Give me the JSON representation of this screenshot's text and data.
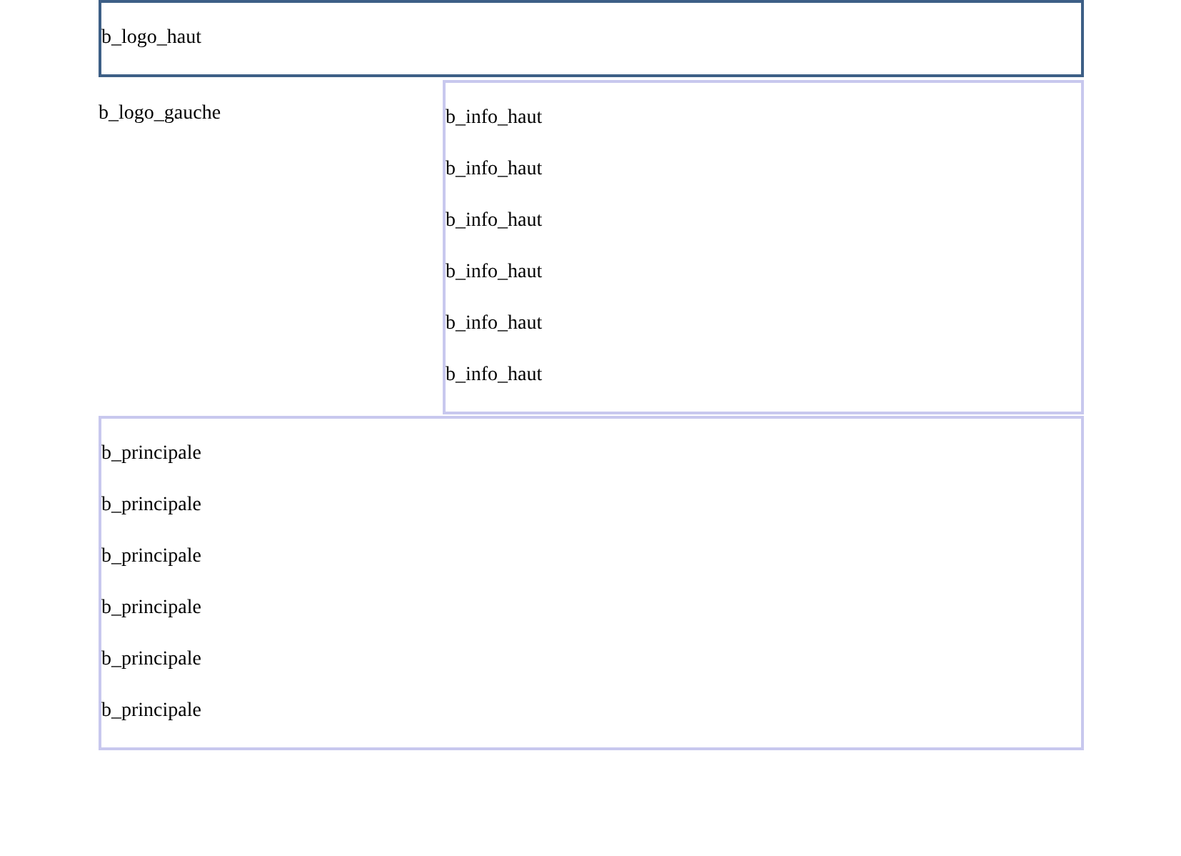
{
  "header": {
    "label": "b_logo_haut"
  },
  "left_column": {
    "label": "b_logo_gauche"
  },
  "info_panel": {
    "lines": [
      "b_info_haut",
      "b_info_haut",
      "b_info_haut",
      "b_info_haut",
      "b_info_haut",
      "b_info_haut"
    ]
  },
  "main_panel": {
    "lines": [
      "b_principale",
      "b_principale",
      "b_principale",
      "b_principale",
      "b_principale",
      "b_principale"
    ]
  }
}
